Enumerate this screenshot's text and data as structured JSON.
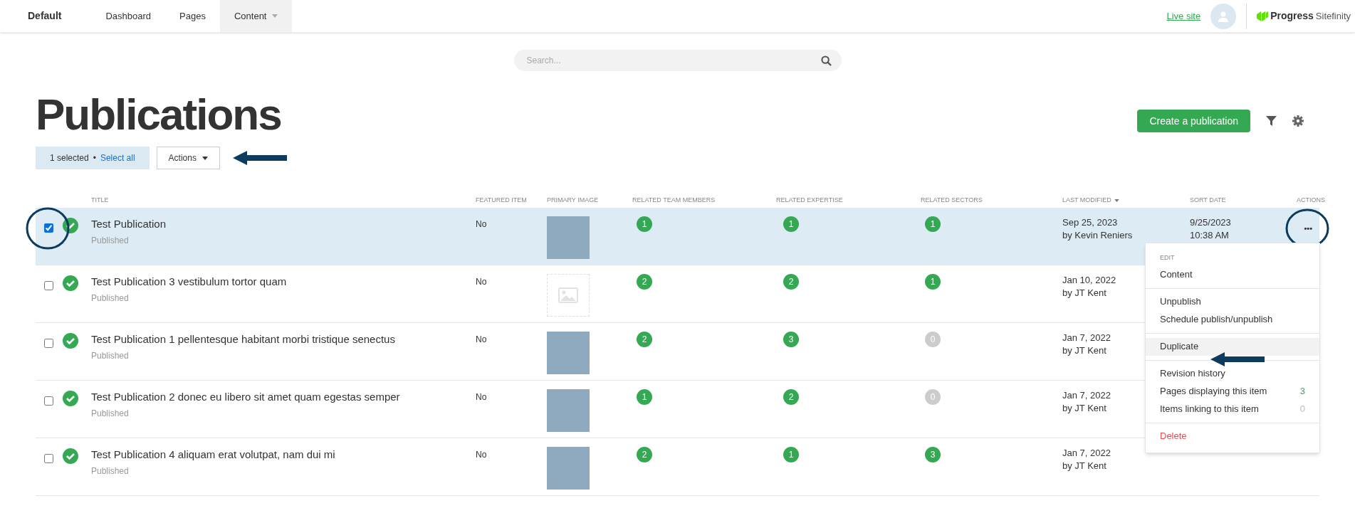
{
  "topbar": {
    "site": "Default",
    "tabs": [
      {
        "label": "Dashboard",
        "selected": false,
        "dropdown": false
      },
      {
        "label": "Pages",
        "selected": false,
        "dropdown": false
      },
      {
        "label": "Content",
        "selected": true,
        "dropdown": true
      }
    ],
    "live_site": "Live site",
    "brand": "Progress",
    "product": "Sitefinity"
  },
  "search": {
    "placeholder": "Search..."
  },
  "title": "Publications",
  "selection": {
    "count": "1 selected",
    "bullet": "•",
    "select_all": "Select all"
  },
  "actions_button": "Actions",
  "create_button": "Create a publication",
  "table": {
    "columns": [
      {
        "label": "TITLE",
        "sorted": false
      },
      {
        "label": "FEATURED ITEM",
        "sorted": false
      },
      {
        "label": "PRIMARY IMAGE",
        "sorted": false
      },
      {
        "label": "RELATED TEAM MEMBERS",
        "sorted": false
      },
      {
        "label": "RELATED EXPERTISE",
        "sorted": false
      },
      {
        "label": "RELATED SECTORS",
        "sorted": false
      },
      {
        "label": "LAST MODIFIED",
        "sorted": true
      },
      {
        "label": "SORT DATE",
        "sorted": false
      },
      {
        "label": "ACTIONS",
        "sorted": false
      }
    ],
    "rows": [
      {
        "checked": true,
        "selected": true,
        "title": "Test Publication",
        "status": "Published",
        "featured": "No",
        "kind": "photo",
        "team": {
          "count": "1",
          "color": "#34a853"
        },
        "expertise": {
          "count": "1",
          "color": "#34a853"
        },
        "sectors": {
          "count": "1",
          "color": "#34a853"
        },
        "modified": "Sep 25, 2023",
        "modified_by": "by Kevin Reniers",
        "sort_date": "9/25/2023",
        "sort_time": "10:38 AM",
        "actions": "•••"
      },
      {
        "checked": false,
        "selected": false,
        "title": "Test Publication 3 vestibulum tortor quam",
        "status": "Published",
        "featured": "No",
        "kind": "no-image",
        "team": {
          "count": "2",
          "color": "#34a853"
        },
        "expertise": {
          "count": "2",
          "color": "#34a853"
        },
        "sectors": {
          "count": "1",
          "color": "#34a853"
        },
        "modified": "Jan 10, 2022",
        "modified_by": "by JT Kent"
      },
      {
        "checked": false,
        "selected": false,
        "title": "Test Publication 1 pellentesque habitant morbi tristique senectus",
        "status": "Published",
        "featured": "No",
        "kind": "photo",
        "team": {
          "count": "2",
          "color": "#34a853"
        },
        "expertise": {
          "count": "3",
          "color": "#34a853"
        },
        "sectors": {
          "count": "0",
          "color": "#cccccc"
        },
        "modified": "Jan 7, 2022",
        "modified_by": "by JT Kent"
      },
      {
        "checked": false,
        "selected": false,
        "title": "Test Publication 2 donec eu libero sit amet quam egestas semper",
        "status": "Published",
        "featured": "No",
        "kind": "photo",
        "team": {
          "count": "1",
          "color": "#34a853"
        },
        "expertise": {
          "count": "2",
          "color": "#34a853"
        },
        "sectors": {
          "count": "0",
          "color": "#cccccc"
        },
        "modified": "Jan 7, 2022",
        "modified_by": "by JT Kent"
      },
      {
        "checked": false,
        "selected": false,
        "title": "Test Publication 4 aliquam erat volutpat, nam dui mi",
        "status": "Published",
        "featured": "No",
        "kind": "photo",
        "team": {
          "count": "2",
          "color": "#34a853"
        },
        "expertise": {
          "count": "1",
          "color": "#34a853"
        },
        "sectors": {
          "count": "3",
          "color": "#34a853"
        },
        "modified": "Jan 7, 2022",
        "modified_by": "by JT Kent"
      }
    ]
  },
  "menu": {
    "sections": [
      {
        "header": "EDIT",
        "items": [
          {
            "label": "Content",
            "kind": "plain",
            "highlighted": false
          }
        ]
      },
      {
        "items": [
          {
            "label": "Unpublish",
            "kind": "plain",
            "highlighted": false
          },
          {
            "label": "Schedule publish/unpublish",
            "kind": "plain",
            "highlighted": false
          }
        ]
      },
      {
        "items": [
          {
            "label": "Duplicate",
            "kind": "plain",
            "highlighted": true
          }
        ]
      },
      {
        "items": [
          {
            "label": "Revision history",
            "kind": "plain",
            "highlighted": false
          },
          {
            "label": "Pages displaying this item",
            "kind": "count",
            "count": "3",
            "color": "#34a853",
            "highlighted": false
          },
          {
            "label": "Items linking to this item",
            "kind": "count",
            "count": "0",
            "color": "#bbbbbb",
            "highlighted": false
          }
        ]
      },
      {
        "items": [
          {
            "label": "Delete",
            "kind": "danger",
            "highlighted": false
          }
        ]
      }
    ]
  }
}
